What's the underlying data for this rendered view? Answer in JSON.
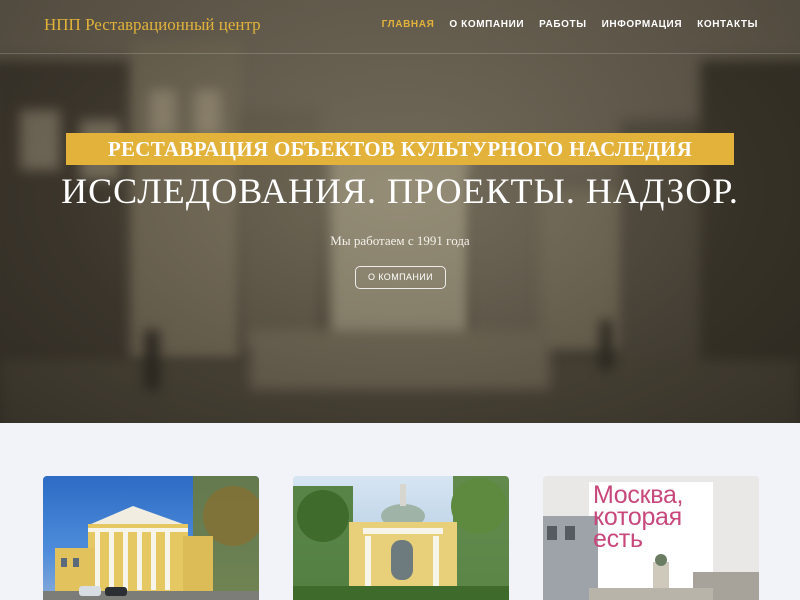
{
  "header": {
    "brand": "НПП Реставрационный центр",
    "nav": [
      {
        "label": "ГЛАВНАЯ",
        "active": true
      },
      {
        "label": "О КОМПАНИИ",
        "active": false
      },
      {
        "label": "РАБОТЫ",
        "active": false
      },
      {
        "label": "ИНФОРМАЦИЯ",
        "active": false
      },
      {
        "label": "КОНТАКТЫ",
        "active": false
      }
    ]
  },
  "hero": {
    "tagline": "РЕСТАВРАЦИЯ ОБЪЕКТОВ КУЛЬТУРНОГО НАСЛЕДИЯ",
    "headline": "ИССЛЕДОВАНИЯ. ПРОЕКТЫ. НАДЗОР.",
    "since": "Мы работаем с 1991 года",
    "button": "О КОМПАНИИ"
  },
  "cards": [
    {
      "image": "yellow-classical-mansion"
    },
    {
      "image": "yellow-pavilion-rotunda"
    },
    {
      "image": "book-cover",
      "book_title_lines": [
        "Москва,",
        "которая",
        "есть"
      ]
    }
  ],
  "colors": {
    "accent": "#e2b23b",
    "page_background": "#f1f3f8",
    "book_title": "#c8487c"
  }
}
